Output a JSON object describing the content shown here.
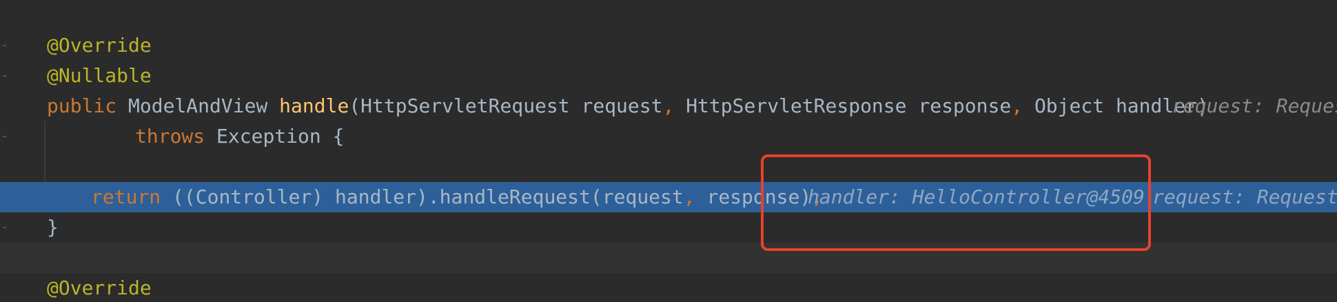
{
  "editor": {
    "lines": [
      {
        "id": "line-override-1",
        "tokens": [
          {
            "type": "annotation",
            "text": "@Override"
          }
        ]
      },
      {
        "id": "line-nullable",
        "tokens": [
          {
            "type": "annotation",
            "text": "@Nullable"
          }
        ]
      },
      {
        "id": "line-signature",
        "tokens": [
          {
            "type": "keyword",
            "text": "public "
          },
          {
            "type": "plain",
            "text": "ModelAndView "
          },
          {
            "type": "method-decl",
            "text": "handle"
          },
          {
            "type": "plain",
            "text": "(HttpServletRequest request"
          },
          {
            "type": "punct",
            "text": ", "
          },
          {
            "type": "plain",
            "text": "HttpServletResponse response"
          },
          {
            "type": "punct",
            "text": ", "
          },
          {
            "type": "plain",
            "text": "Object handler)"
          }
        ],
        "inlay": "request: Reques"
      },
      {
        "id": "line-throws",
        "tokens": [
          {
            "type": "keyword",
            "text": "throws "
          },
          {
            "type": "plain",
            "text": "Exception {"
          }
        ]
      },
      {
        "id": "line-return",
        "tokens": [
          {
            "type": "keyword",
            "text": "return "
          },
          {
            "type": "plain",
            "text": "((Controller) handler).handleRequest(request"
          },
          {
            "type": "punct",
            "text": ", "
          },
          {
            "type": "plain",
            "text": "response)"
          },
          {
            "type": "punct",
            "text": ";"
          }
        ],
        "inlay_handler": "handler: HelloController@4509",
        "inlay_request": "request: RequestF"
      },
      {
        "id": "line-close-brace",
        "tokens": [
          {
            "type": "plain",
            "text": "}"
          }
        ]
      },
      {
        "id": "line-override-2",
        "tokens": [
          {
            "type": "annotation",
            "text": "@Override"
          }
        ]
      }
    ]
  },
  "colors": {
    "background": "#2b2b2b",
    "current_line": "#2d6099",
    "annotation": "#bbb529",
    "keyword": "#cc7832",
    "method_declaration": "#ffc66d",
    "plain_text": "#a9b7c6",
    "highlight_box": "#e8412c"
  }
}
